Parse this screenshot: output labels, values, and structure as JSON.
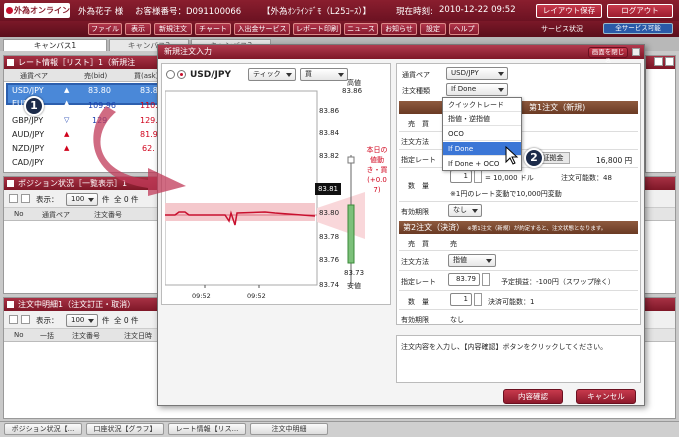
{
  "header": {
    "logo_text": "外為オンライン",
    "user_name": "外為花子 様",
    "customer_no": "お客様番号：D091100066",
    "course": "【外為ｵﾝﾗｲﾝﾃﾞﾓ（L25ｺｰｽ）】",
    "current_time_label": "現在時刻:",
    "current_time": "2010-12-22 09:52",
    "layout_save": "レイアウト保存",
    "logout": "ログアウト"
  },
  "menu": [
    "ファイル",
    "表示",
    "新規注文",
    "チャート",
    "入出金サービス",
    "レポート印刷",
    "ニュース",
    "お知らせ",
    "設定",
    "ヘルプ"
  ],
  "service_status": {
    "label": "サービス状況",
    "value": "全サービス可能"
  },
  "tabs": [
    "キャンバス1",
    "キャンバス2",
    "キャンバス3"
  ],
  "rate_panel": {
    "title": "レート情報［リスト］1（新規注",
    "headers": [
      "通貨ペア",
      "売(bid)",
      "買(ask)"
    ],
    "rows": [
      {
        "pair": "USD/JPY",
        "bid": "83.80",
        "ask": "83.8"
      },
      {
        "pair": "EUR/JPY",
        "bid": "109.96",
        "ask": "110.0"
      },
      {
        "pair": "GBP/JPY",
        "bid": "129",
        "ask": "129.6"
      },
      {
        "pair": "AUD/JPY",
        "bid": "",
        "ask": "81.9"
      },
      {
        "pair": "NZD/JPY",
        "bid": "",
        "ask": "62."
      },
      {
        "pair": "CAD/JPY",
        "bid": "",
        "ask": ""
      }
    ]
  },
  "position_panel": {
    "title": "ポジション状況［一覧表示］1",
    "display_label": "表示：",
    "display_count": "100",
    "count_unit": "件",
    "total": "全 0 件",
    "headers": [
      "No",
      "通貨ペア",
      "注文番号"
    ]
  },
  "order_panel": {
    "title": "注文中明細1（注文訂正・取消）",
    "display_label": "表示：",
    "display_count": "100",
    "count_unit": "件",
    "total": "全 0 件",
    "headers": [
      "No",
      "一括",
      "注文番号",
      "注文日時"
    ]
  },
  "dialog": {
    "title": "新規注文入力",
    "close_label": "画面を閉じる",
    "chart": {
      "pair": "USD/JPY",
      "tick_select": "ティック",
      "side_select": "買",
      "high_label": "高値",
      "high_value": "83.86",
      "low_label": "安値",
      "low_value": "83.73",
      "y_ticks": [
        "83.86",
        "83.84",
        "83.82",
        "83.80",
        "83.78",
        "83.76",
        "83.74"
      ],
      "current_price": "83.81",
      "x_ticks": [
        "09:52",
        "09:52"
      ],
      "side_note": "本日の値動き・買(+0.07)"
    },
    "form": {
      "pair_label": "通貨ペア",
      "pair_value": "USD/JPY",
      "order_type_label": "注文種類",
      "order_type_value": "If Done",
      "section1": "第1注文（新規)",
      "buy_sell_label": "売　買",
      "method_label": "注文方法",
      "price_label": "指定レート",
      "margin_label": "証拠金",
      "margin_value": "16,800 円",
      "qty_label": "数　量",
      "qty_value": "1",
      "qty_calc": "= 10,000 ドル",
      "orderable_label": "注文可能数：48",
      "note": "※1円のレート変動で10,000円変動",
      "expiry_label": "有効期限",
      "expiry_value": "なし",
      "section2": "第2注文（決済）",
      "section2_note": "※第1注文（新規）が約定すると、注文状態となります。",
      "s2_buy_sell_value": "売",
      "s2_method_value": "指値",
      "s2_price_value": "83.79",
      "s2_expected": "予定損益：-100円（スワップ除く）",
      "s2_qty_value": "1",
      "s2_orderable": "決済可能数：1",
      "s2_expiry_value": "なし",
      "message": "注文内容を入力し、【内容確認】ボタンをクリックしてください。",
      "confirm_button": "内容確認",
      "cancel_button": "キャンセル"
    },
    "dropdown_options": [
      "クイックトレード",
      "指値・逆指値",
      "OCO",
      "If Done",
      "If Done + OCO"
    ],
    "dropdown_selected": "If Done"
  },
  "taskbar": [
    "ポジション状況【...",
    "口座状況【グラフ】",
    "レート情報【リス...",
    "注文中明細"
  ],
  "callouts": [
    "1",
    "2"
  ]
}
